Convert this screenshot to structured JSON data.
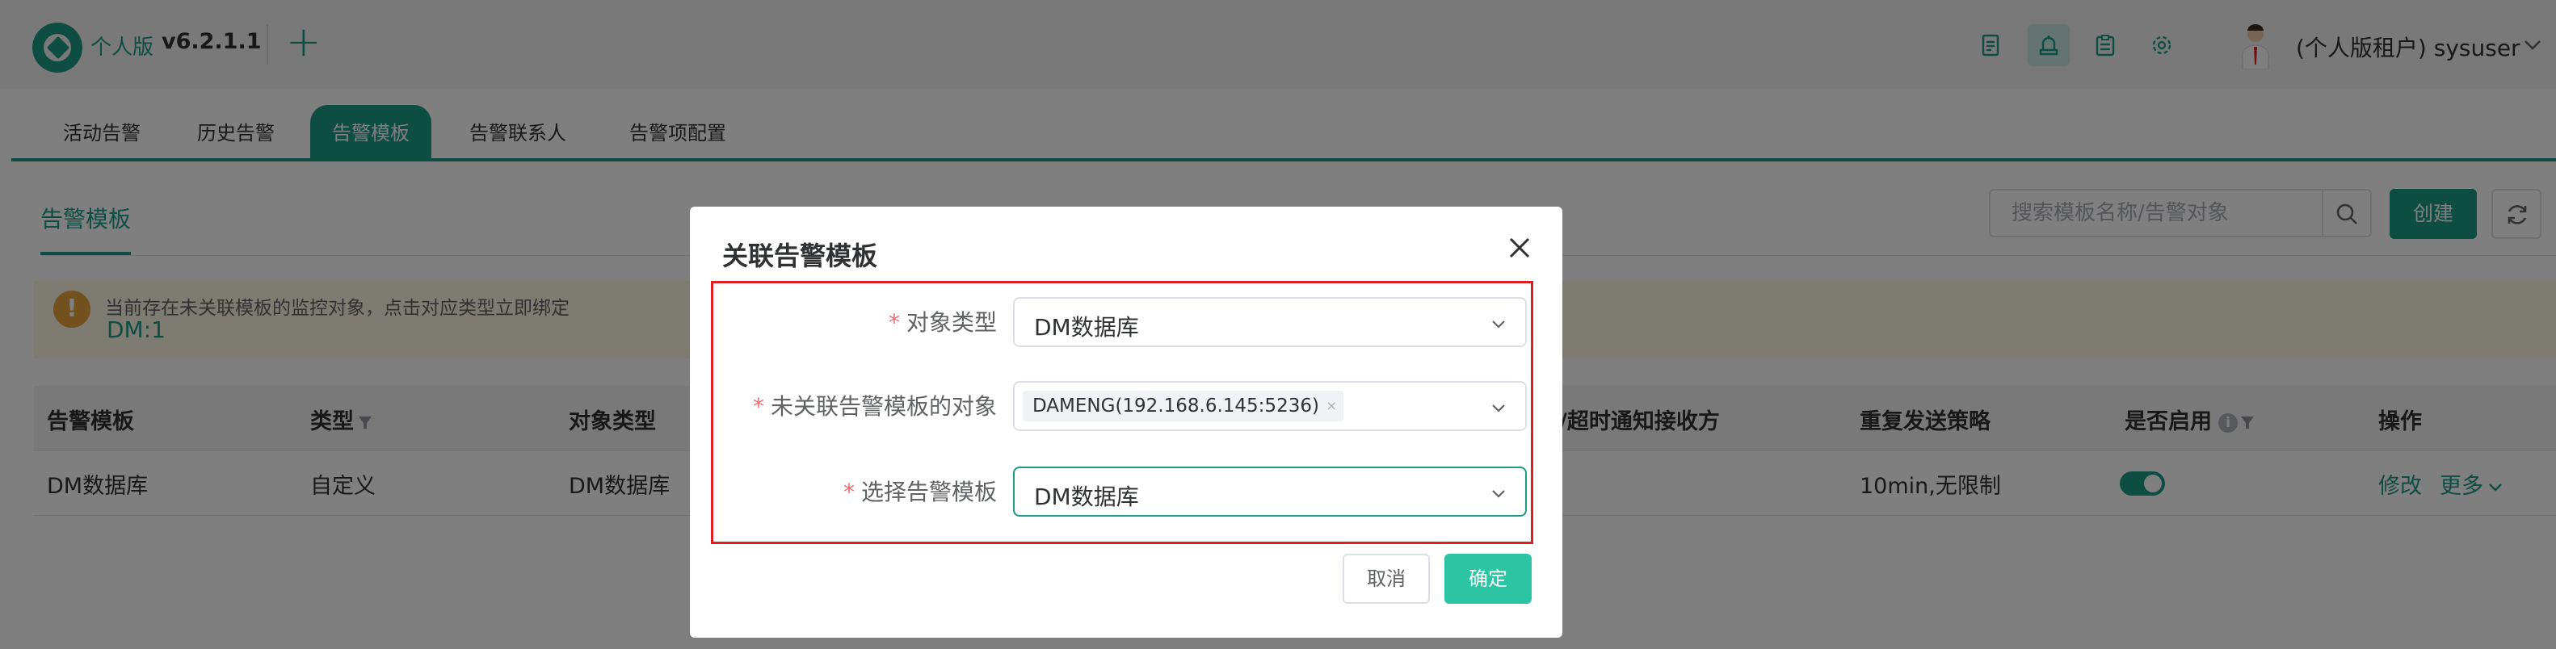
{
  "header": {
    "edition": "个人版",
    "version": "v6.2.1.1",
    "add_symbol": "+",
    "toolbar_icons": [
      "document-icon",
      "alert-tower-icon",
      "clipboard-icon",
      "settings-icon"
    ],
    "user": "(个人版租户) sysuser"
  },
  "tabs": [
    {
      "label": "活动告警",
      "active": false
    },
    {
      "label": "历史告警",
      "active": false
    },
    {
      "label": "告警模板",
      "active": true
    },
    {
      "label": "告警联系人",
      "active": false
    },
    {
      "label": "告警项配置",
      "active": false
    }
  ],
  "page": {
    "title": "告警模板",
    "search_placeholder": "搜索模板名称/告警对象",
    "create_label": "创建"
  },
  "banner": {
    "text": "当前存在未关联模板的监控对象，点击对应类型立即绑定",
    "link": "DM:1"
  },
  "table": {
    "columns": [
      "告警模板",
      "类型",
      "对象类型",
      "/超时通知接收方",
      "重复发送策略",
      "是否启用",
      "操作"
    ],
    "rows": [
      {
        "template": "DM数据库",
        "type": "自定义",
        "object_type": "DM数据库",
        "repeat_policy": "10min,无限制",
        "enabled": true,
        "edit": "修改",
        "more": "更多"
      }
    ]
  },
  "dialog": {
    "title": "关联告警模板",
    "fields": [
      {
        "label": "对象类型",
        "value": "DM数据库"
      },
      {
        "label": "未关联告警模板的对象",
        "tag": "DAMENG(192.168.6.145:5236)"
      },
      {
        "label": "选择告警模板",
        "value": "DM数据库"
      }
    ],
    "required_mark": "*",
    "cancel_label": "取消",
    "ok_label": "确定"
  },
  "colors": {
    "primary": "#1d9a83",
    "confirm": "#2bc5a3",
    "warning": "#e6a23c",
    "highlight": "#e02020"
  }
}
